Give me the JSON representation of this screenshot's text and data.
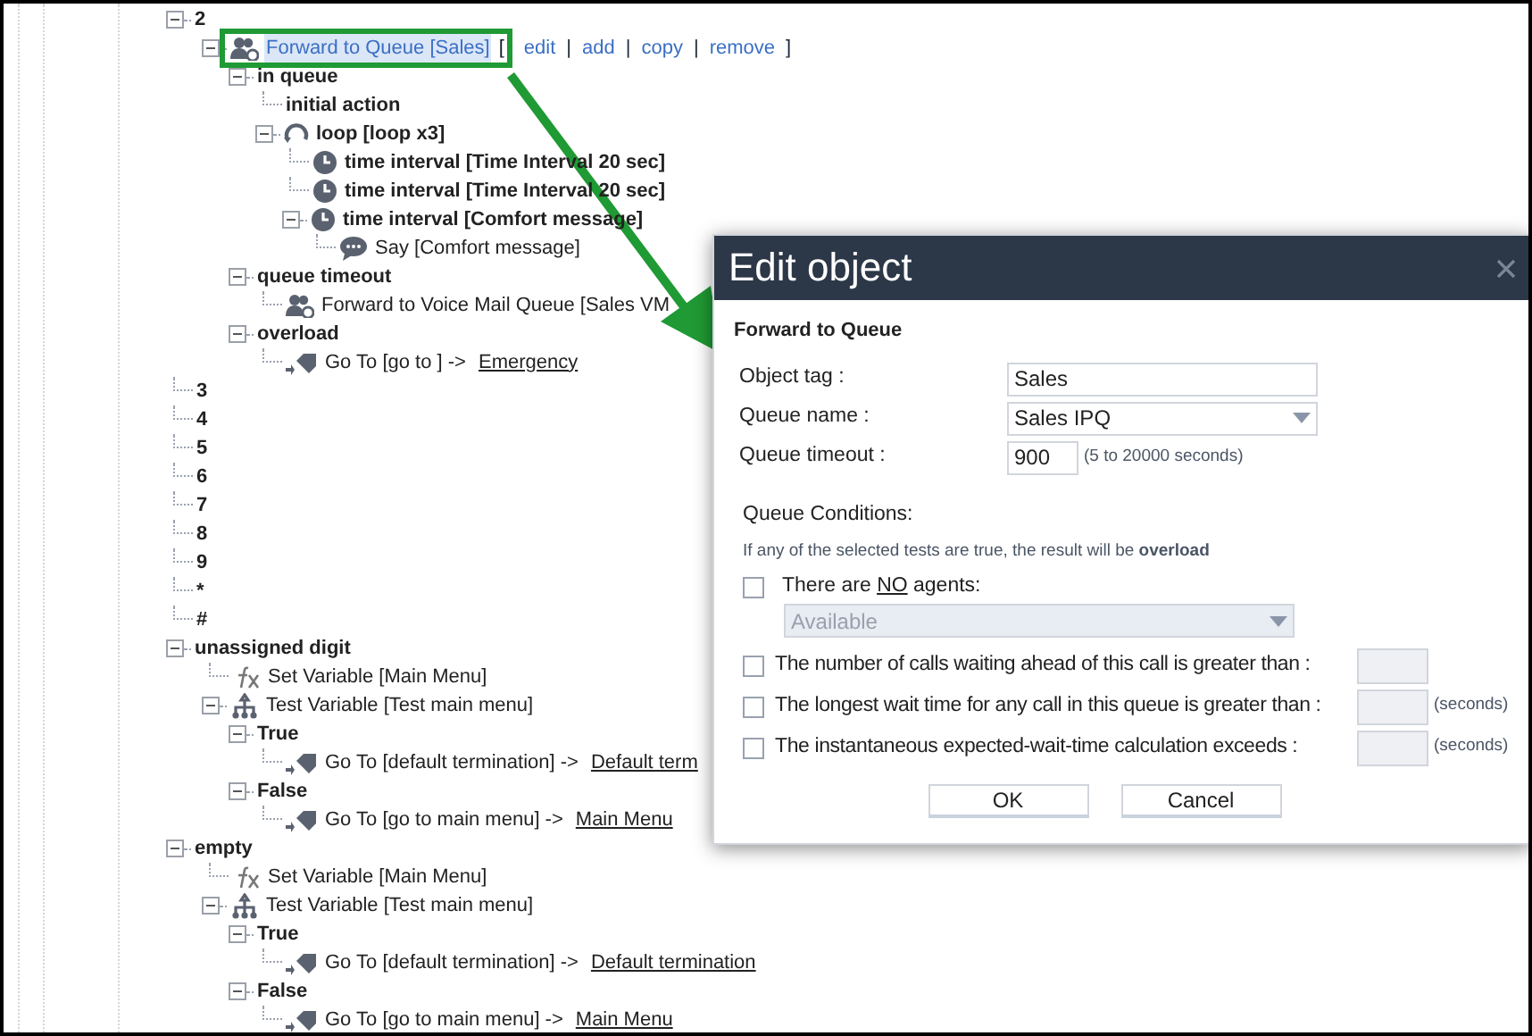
{
  "tree": [
    {
      "text": "2",
      "kind": "label",
      "expanded": true,
      "children": [
        {
          "text": "Forward to Queue [Sales]",
          "kind": "queue",
          "expanded": true,
          "selected": true,
          "links": {
            "open": "[",
            "items": [
              {
                "label": "edit",
                "after": "|"
              },
              {
                "label": "add",
                "after": "|"
              },
              {
                "label": "copy",
                "after": "|"
              },
              {
                "label": "remove",
                "after": "]"
              }
            ]
          },
          "children": [
            {
              "text": "in queue",
              "kind": "label",
              "expanded": true,
              "children": [
                {
                  "text": "initial action",
                  "kind": "label",
                  "expanded": false
                },
                {
                  "text": "loop [loop x3]",
                  "kind": "loop",
                  "expanded": true,
                  "children": [
                    {
                      "text": "time interval [Time Interval 20 sec]",
                      "kind": "clock",
                      "expanded": false
                    },
                    {
                      "text": "time interval [Time Interval 20 sec]",
                      "kind": "clock",
                      "expanded": false
                    },
                    {
                      "text": "time interval [Comfort message]",
                      "kind": "clock",
                      "expanded": true,
                      "children": [
                        {
                          "text": "Say [Comfort message]",
                          "kind": "say",
                          "expanded": false
                        }
                      ]
                    }
                  ]
                }
              ]
            },
            {
              "text": "queue timeout",
              "kind": "label",
              "expanded": true,
              "children": [
                {
                  "text": "Forward to Voice Mail Queue [Sales VM",
                  "kind": "queue",
                  "expanded": false
                }
              ]
            },
            {
              "text": "overload",
              "kind": "label",
              "expanded": true,
              "children": [
                {
                  "text": "Go To [go to ] ->",
                  "target": "Emergency",
                  "kind": "goto",
                  "expanded": false
                }
              ]
            }
          ]
        }
      ]
    },
    {
      "text": "3",
      "kind": "label",
      "expanded": false
    },
    {
      "text": "4",
      "kind": "label",
      "expanded": false
    },
    {
      "text": "5",
      "kind": "label",
      "expanded": false
    },
    {
      "text": "6",
      "kind": "label",
      "expanded": false
    },
    {
      "text": "7",
      "kind": "label",
      "expanded": false
    },
    {
      "text": "8",
      "kind": "label",
      "expanded": false
    },
    {
      "text": "9",
      "kind": "label",
      "expanded": false
    },
    {
      "text": "*",
      "kind": "label",
      "expanded": false
    },
    {
      "text": "#",
      "kind": "label",
      "expanded": false
    },
    {
      "text": "unassigned digit",
      "kind": "label",
      "expanded": true,
      "children": [
        {
          "text": "Set Variable [Main Menu]",
          "kind": "function",
          "expanded": false
        },
        {
          "text": "Test Variable [Test main menu]",
          "kind": "test",
          "expanded": true,
          "children": [
            {
              "text": "True",
              "kind": "label",
              "expanded": true,
              "children": [
                {
                  "text": "Go To [default termination] ->",
                  "target": "Default term",
                  "kind": "goto",
                  "expanded": false
                }
              ]
            },
            {
              "text": "False",
              "kind": "label",
              "expanded": true,
              "children": [
                {
                  "text": "Go To [go to main menu] ->",
                  "target": "Main Menu",
                  "kind": "goto",
                  "expanded": false
                }
              ]
            }
          ]
        }
      ]
    },
    {
      "text": "empty",
      "kind": "label",
      "expanded": true,
      "children": [
        {
          "text": "Set Variable [Main Menu]",
          "kind": "function",
          "expanded": false
        },
        {
          "text": "Test Variable [Test main menu]",
          "kind": "test",
          "expanded": true,
          "children": [
            {
              "text": "True",
              "kind": "label",
              "expanded": true,
              "children": [
                {
                  "text": "Go To [default termination] ->",
                  "target": "Default termination",
                  "kind": "goto",
                  "expanded": false
                }
              ]
            },
            {
              "text": "False",
              "kind": "label",
              "expanded": true,
              "children": [
                {
                  "text": "Go To [go to main menu] ->",
                  "target": "Main Menu",
                  "kind": "goto",
                  "expanded": false
                }
              ]
            }
          ]
        }
      ]
    }
  ],
  "dialog": {
    "title": "Edit object",
    "subtitle": "Forward to Queue",
    "fields": [
      {
        "kind": "text",
        "label": "Object tag :",
        "value": "Sales"
      },
      {
        "kind": "select",
        "label": "Queue name :",
        "value": "Sales IPQ"
      },
      {
        "kind": "number",
        "label": "Queue timeout :",
        "value": "900",
        "hint": "(5 to 20000 seconds)"
      }
    ],
    "conditions_heading": "Queue Conditions:",
    "note": "If any of the selected tests are true, the result will be **overload**",
    "conditions": [
      {
        "kind": "agents",
        "before": "There are ",
        "emphasis": "NO",
        "after": " agents:",
        "checked": false,
        "select": "Available"
      },
      {
        "kind": "threshold",
        "before": "The number of calls waiting ahead of this call is greater than :",
        "checked": false
      },
      {
        "kind": "threshold",
        "before": "The longest wait time for any call in this queue is greater than :",
        "checked": false,
        "unit": "(seconds)"
      },
      {
        "kind": "threshold",
        "before": "The instantaneous expected-wait-time calculation exceeds :",
        "checked": false,
        "unit": "(seconds)"
      }
    ],
    "buttons": [
      "OK",
      "Cancel"
    ]
  }
}
